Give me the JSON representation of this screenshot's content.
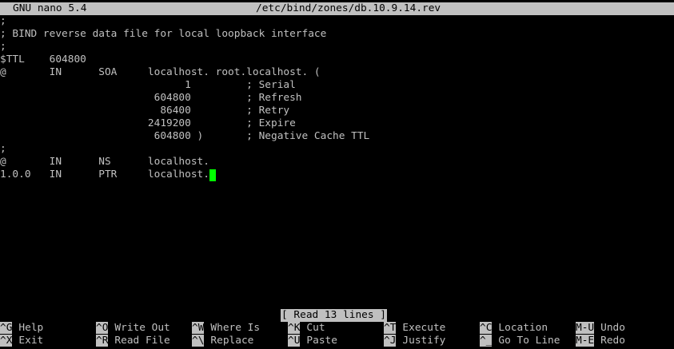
{
  "titlebar": {
    "app": "GNU nano 5.4",
    "file": "/etc/bind/zones/db.10.9.14.rev"
  },
  "editor": {
    "lines": [
      ";",
      "; BIND reverse data file for local loopback interface",
      ";",
      "$TTL    604800",
      "@       IN      SOA     localhost. root.localhost. (",
      "                              1         ; Serial",
      "                         604800         ; Refresh",
      "                          86400         ; Retry",
      "                        2419200         ; Expire",
      "                         604800 )       ; Negative Cache TTL",
      ";",
      "@       IN      NS      localhost.",
      "1.0.0   IN      PTR     localhost."
    ]
  },
  "status": "[ Read 13 lines ]",
  "shortcuts": {
    "row1": [
      {
        "key": "^G",
        "label": "Help"
      },
      {
        "key": "^O",
        "label": "Write Out"
      },
      {
        "key": "^W",
        "label": "Where Is"
      },
      {
        "key": "^K",
        "label": "Cut"
      },
      {
        "key": "^T",
        "label": "Execute"
      },
      {
        "key": "^C",
        "label": "Location"
      },
      {
        "key": "M-U",
        "label": "Undo"
      }
    ],
    "row2": [
      {
        "key": "^X",
        "label": "Exit"
      },
      {
        "key": "^R",
        "label": "Read File"
      },
      {
        "key": "^\\",
        "label": "Replace"
      },
      {
        "key": "^U",
        "label": "Paste"
      },
      {
        "key": "^J",
        "label": "Justify"
      },
      {
        "key": "^_",
        "label": "Go To Line"
      },
      {
        "key": "M-E",
        "label": "Redo"
      }
    ]
  },
  "colors": {
    "background": "#000000",
    "foreground": "#c0c0c0",
    "inverse_bg": "#c0c0c0",
    "inverse_fg": "#000000",
    "cursor": "#00ff00"
  }
}
